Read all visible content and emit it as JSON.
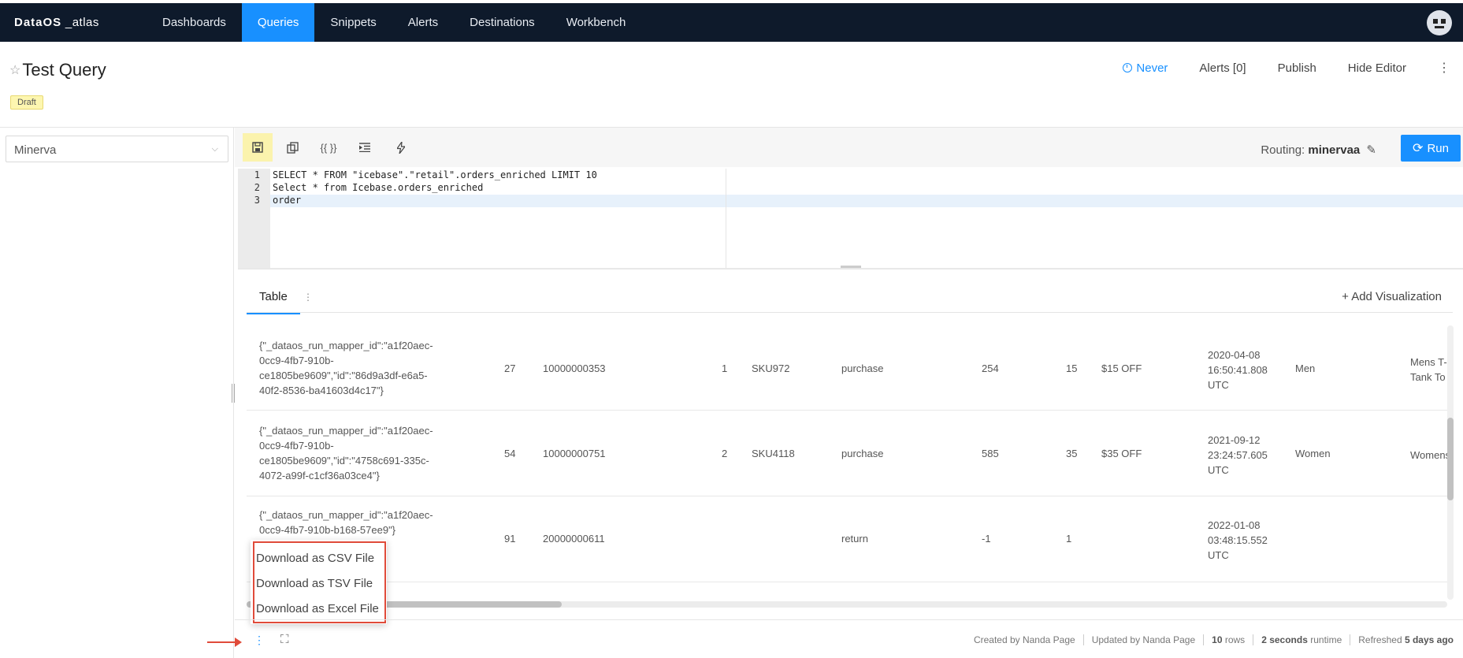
{
  "app": {
    "logo_main": "DataOS",
    "logo_sub": "_atlas"
  },
  "nav": {
    "items": [
      {
        "label": "Dashboards"
      },
      {
        "label": "Queries"
      },
      {
        "label": "Snippets"
      },
      {
        "label": "Alerts"
      },
      {
        "label": "Destinations"
      },
      {
        "label": "Workbench"
      }
    ],
    "active": "Queries"
  },
  "header": {
    "title": "Test Query",
    "badge": "Draft",
    "schedule": "Never",
    "alerts": "Alerts [0]",
    "publish": "Publish",
    "hide_editor": "Hide Editor"
  },
  "datasource": {
    "selected": "Minerva"
  },
  "toolbar": {
    "routing_label": "Routing:",
    "routing_value": "minervaa",
    "run_label": "Run"
  },
  "editor": {
    "lines": [
      {
        "num": "1",
        "text": "SELECT * FROM \"icebase\".\"retail\".orders_enriched LIMIT 10"
      },
      {
        "num": "2",
        "text": "Select * from Icebase.orders_enriched"
      },
      {
        "num": "3",
        "text": "order"
      }
    ]
  },
  "results": {
    "tab_label": "Table",
    "add_visualization": "+ Add Visualization",
    "rows": [
      {
        "json": "{\"_dataos_run_mapper_id\":\"a1f20aec-0cc9-4fb7-910b-ce1805be9609\",\"id\":\"86d9a3df-e6a5-40f2-8536-ba41603d4c17\"}",
        "n1": "27",
        "order_id": "10000000353",
        "qty": "1",
        "sku": "SKU972",
        "type": "purchase",
        "v1": "254",
        "v2": "15",
        "discount": "$15 OFF",
        "date": "2020-04-08 16:50:41.808 UTC",
        "gender": "Men",
        "product": "Mens T-Tank To"
      },
      {
        "json": "{\"_dataos_run_mapper_id\":\"a1f20aec-0cc9-4fb7-910b-ce1805be9609\",\"id\":\"4758c691-335c-4072-a99f-c1cf36a03ce4\"}",
        "n1": "54",
        "order_id": "10000000751",
        "qty": "2",
        "sku": "SKU4118",
        "type": "purchase",
        "v1": "585",
        "v2": "35",
        "discount": "$35 OFF",
        "date": "2021-09-12 23:24:57.605 UTC",
        "gender": "Women",
        "product": "Womens"
      },
      {
        "json": "{\"_dataos_run_mapper_id\":\"a1f20aec-0cc9-4fb7-910b-b168-57ee9\"}",
        "n1": "91",
        "order_id": "20000000611",
        "qty": "",
        "sku": "",
        "type": "return",
        "v1": "-1",
        "v2": "1",
        "discount": "",
        "date": "2022-01-08 03:48:15.552 UTC",
        "gender": "",
        "product": ""
      }
    ]
  },
  "download_menu": [
    {
      "label": "Download as CSV File"
    },
    {
      "label": "Download as TSV File"
    },
    {
      "label": "Download as Excel File"
    }
  ],
  "footer": {
    "created_by": "Created by Nanda Page",
    "updated_by": "Updated by Nanda Page",
    "rows_count": "10",
    "rows_label": "rows",
    "runtime_value": "2 seconds",
    "runtime_label": "runtime",
    "refreshed_label": "Refreshed",
    "refreshed_value": "5 days ago"
  },
  "colors": {
    "nav_bg": "#0e1a2b",
    "accent": "#1890ff",
    "annotation": "#e04b3a",
    "draft": "#fdf6b0"
  }
}
